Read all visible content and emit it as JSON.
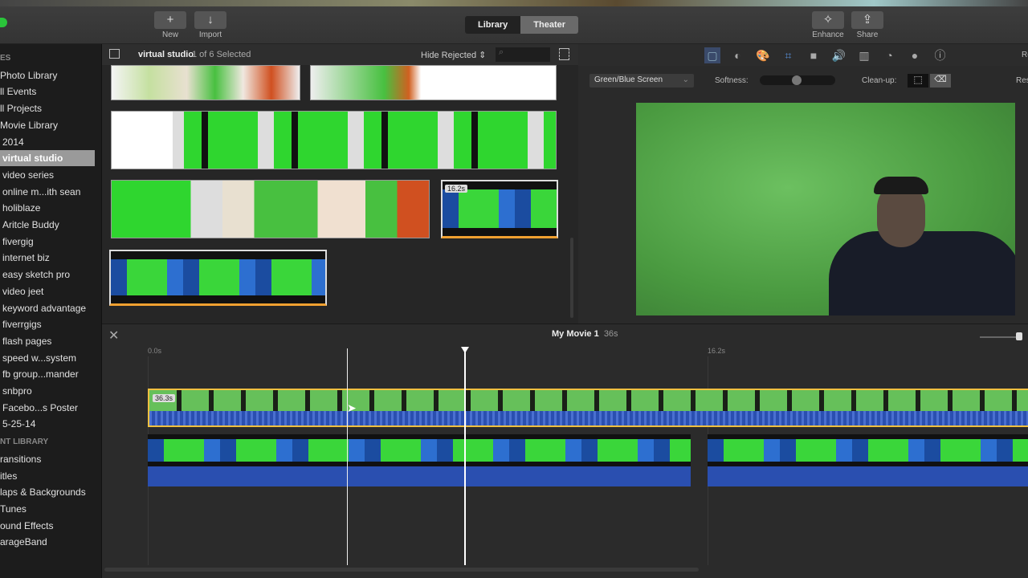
{
  "toolbar": {
    "new": "New",
    "import": "Import",
    "library": "Library",
    "theater": "Theater",
    "enhance": "Enhance",
    "share": "Share"
  },
  "sidebar": {
    "header1": "ES",
    "items": [
      "Photo Library",
      "ll Events",
      "ll Projects",
      "Movie Library",
      "2014",
      "virtual studio",
      "video series",
      "online m...ith sean",
      "holiblaze",
      "Aritcle Buddy",
      "fivergig",
      "internet biz",
      "easy sketch pro",
      "video jeet",
      "keyword advantage",
      "fiverrgigs",
      "flash pages",
      "speed w...system",
      "fb group...mander",
      "snbpro",
      "Facebo...s Poster",
      "5-25-14"
    ],
    "selected": "virtual studio",
    "header2": "NT LIBRARY",
    "content": [
      "ransitions",
      "itles",
      "laps & Backgrounds",
      "Tunes",
      "ound Effects",
      "arageBand"
    ]
  },
  "browser": {
    "event": "virtual studio",
    "selection": "1 of 6 Selected",
    "filter": "Hide Rejected",
    "search_placeholder": "",
    "clip_duration": "16.2s"
  },
  "viewer": {
    "effect": "Green/Blue Screen",
    "softness_label": "Softness:",
    "softness_value": 0.5,
    "cleanup_label": "Clean-up:",
    "reset": "Re",
    "reset2": "Res"
  },
  "timeline": {
    "title": "My Movie 1",
    "duration": "36s",
    "tick0": "0.0s",
    "tick1": "16.2s",
    "clip_duration": "36.3s"
  },
  "colors": {
    "selection": "#f0b030",
    "green": "#2fd62f",
    "audio": "#2a4fb0"
  }
}
